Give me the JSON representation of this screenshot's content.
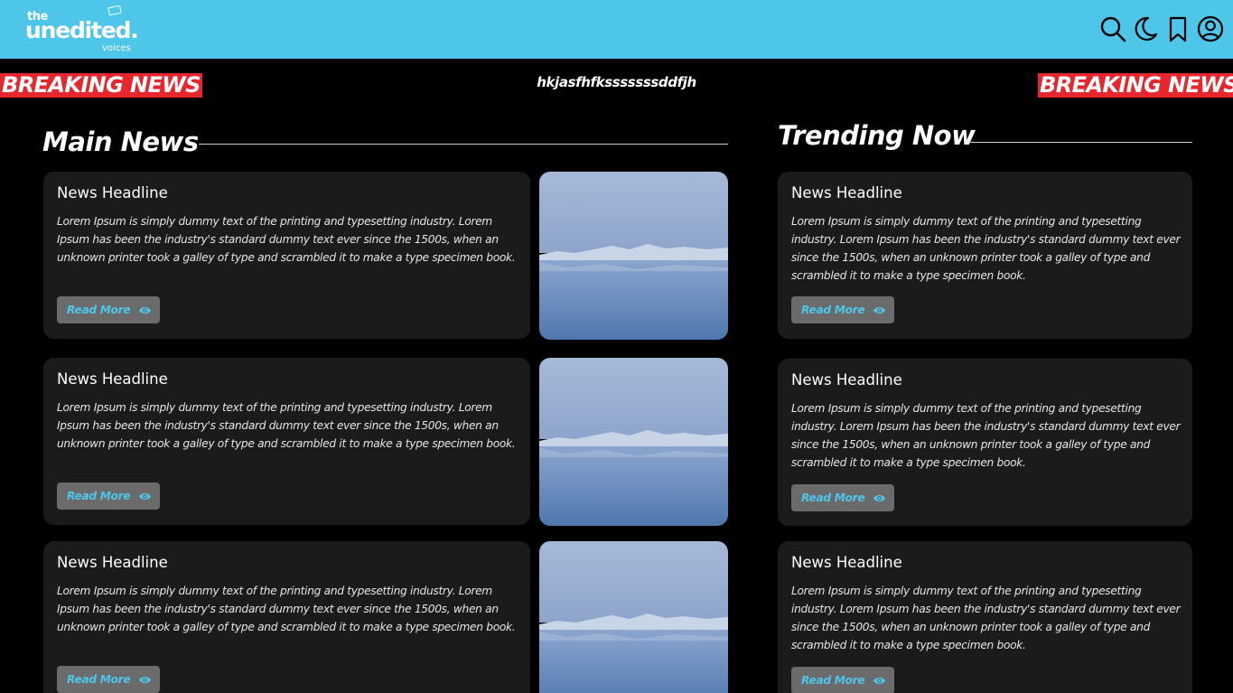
{
  "header": {
    "logo": {
      "top": "the",
      "brand": "unedited.",
      "sub": "voices"
    },
    "icons": [
      "search-icon",
      "moon-icon",
      "bookmark-icon",
      "user-icon"
    ],
    "bg_color": "#4ec6ea"
  },
  "ticker": {
    "breaking_label_left": "BREAKING NEWS",
    "breaking_label_right": "BREAKING NEWS",
    "text": "hkjasfhfksssssssddfjh",
    "badge_color": "#e8262e"
  },
  "main": {
    "title": "Main News",
    "articles": [
      {
        "headline": "News Headline",
        "body": "Lorem Ipsum is simply dummy text of the printing and typesetting industry. Lorem Ipsum has been the industry's standard dummy text ever since the 1500s, when an unknown printer took a galley of type and scrambled it to make a type specimen book.",
        "button": "Read More"
      },
      {
        "headline": "News Headline",
        "body": "Lorem Ipsum is simply dummy text of the printing and typesetting industry. Lorem Ipsum has been the industry's standard dummy text ever since the 1500s, when an unknown printer took a galley of type and scrambled it to make a type specimen book.",
        "button": "Read More"
      },
      {
        "headline": "News Headline",
        "body": "Lorem Ipsum is simply dummy text of the printing and typesetting industry. Lorem Ipsum has been the industry's standard dummy text ever since the 1500s, when an unknown printer took a galley of type and scrambled it to make a type specimen book.",
        "button": "Read More"
      }
    ]
  },
  "trending": {
    "title": "Trending Now",
    "articles": [
      {
        "headline": "News Headline",
        "body": "Lorem Ipsum is simply dummy text of the printing and typesetting industry. Lorem Ipsum has been the industry's standard dummy text ever since the 1500s, when an unknown printer took a galley of type and scrambled it to make a type specimen book.",
        "button": "Read More"
      },
      {
        "headline": "News Headline",
        "body": "Lorem Ipsum is simply dummy text of the printing and typesetting industry. Lorem Ipsum has been the industry's standard dummy text ever since the 1500s, when an unknown printer took a galley of type and scrambled it to make a type specimen book.",
        "button": "Read More"
      },
      {
        "headline": "News Headline",
        "body": "Lorem Ipsum is simply dummy text of the printing and typesetting industry. Lorem Ipsum has been the industry's standard dummy text ever since the 1500s, when an unknown printer took a galley of type and scrambled it to make a type specimen book.",
        "button": "Read More"
      }
    ]
  },
  "theme": {
    "background": "#000000",
    "card_bg": "#1b1b1b",
    "button_bg": "#6b6b6b",
    "accent": "#4ec6ea"
  }
}
